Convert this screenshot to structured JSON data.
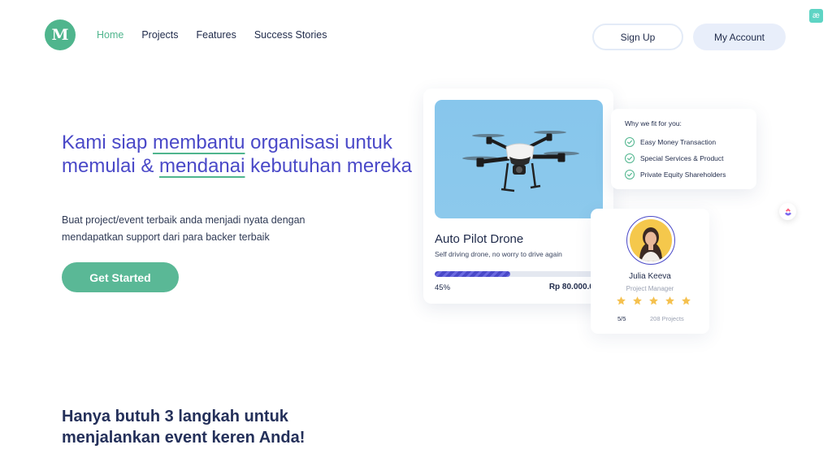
{
  "brand": {
    "logo_letter": "M"
  },
  "nav": {
    "items": [
      {
        "label": "Home",
        "active": true
      },
      {
        "label": "Projects",
        "active": false
      },
      {
        "label": "Features",
        "active": false
      },
      {
        "label": "Success Stories",
        "active": false
      }
    ]
  },
  "header": {
    "signup_label": "Sign Up",
    "account_label": "My Account",
    "extension_badge": "æ"
  },
  "hero": {
    "title_part1": "Kami siap ",
    "title_hl1": "membantu",
    "title_part2": " organisasi untuk memulai & ",
    "title_hl2": "mendanai",
    "title_part3": " kebutuhan mereka",
    "subtitle": "Buat project/event terbaik anda menjadi nyata dengan mendapatkan support dari para backer terbaik",
    "cta_label": "Get Started"
  },
  "project_card": {
    "title": "Auto Pilot Drone",
    "description": "Self driving drone, no worry to drive again",
    "progress_percent": 45,
    "progress_label": "45%",
    "amount": "Rp 80.000.000"
  },
  "why_card": {
    "title": "Why we fit for you:",
    "items": [
      "Easy Money Transaction",
      "Special Services & Product",
      "Private Equity Shareholders"
    ]
  },
  "profile_card": {
    "name": "Julia Keeva",
    "role": "Project Manager",
    "stars": 5,
    "rating_label": "5/5",
    "projects_label": "208 Projects"
  },
  "steps_section": {
    "title": "Hanya butuh 3 langkah untuk menjalankan event keren Anda!"
  },
  "colors": {
    "accent_green": "#4fb58d",
    "accent_purple": "#4a49c8",
    "star_yellow": "#f5c14f"
  }
}
